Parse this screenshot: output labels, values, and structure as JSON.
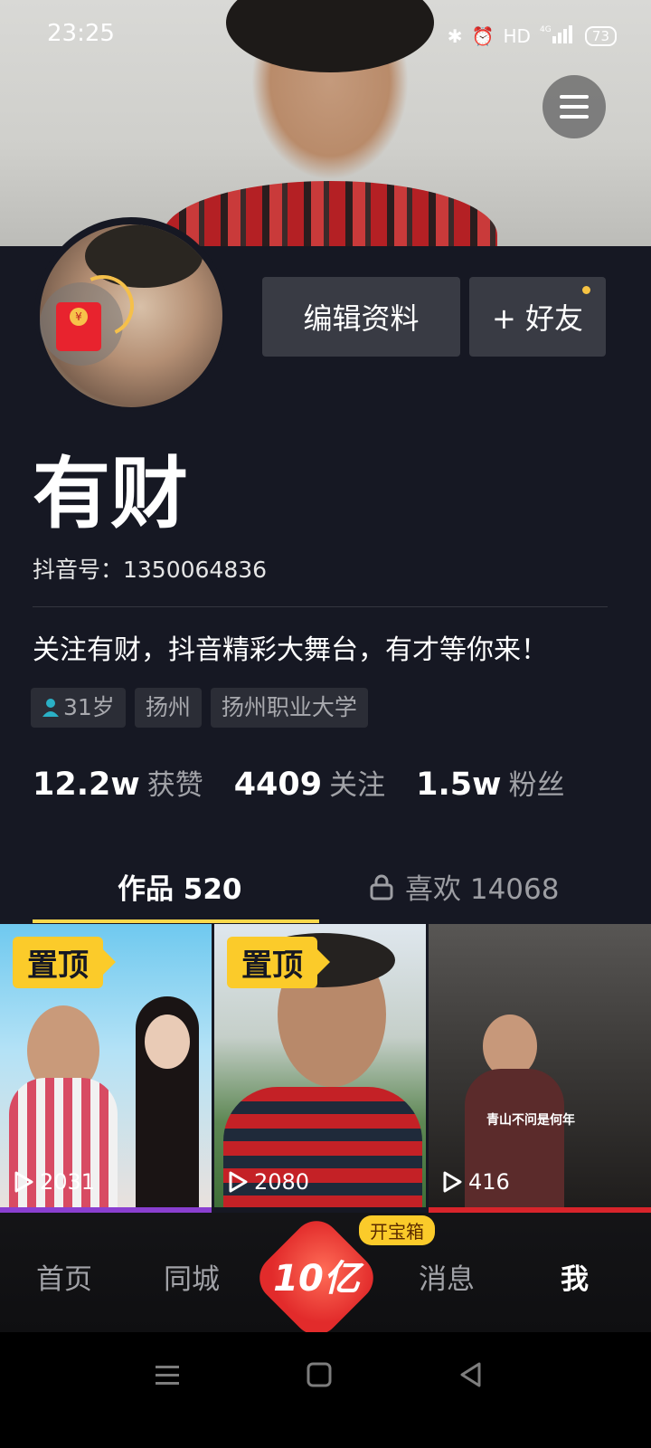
{
  "status_bar": {
    "time": "23:25",
    "network": "HD",
    "signal": "4G",
    "battery": "73"
  },
  "profile": {
    "name": "有财",
    "douyin_id": "抖音号：1350064836",
    "bio": "关注有财，抖音精彩大舞台，有才等你来！",
    "tags": [
      "31岁",
      "扬州",
      "扬州职业大学"
    ],
    "edit_label": "编辑资料",
    "friend_label": "+ 好友"
  },
  "stats": [
    {
      "value": "12.2w",
      "label": "获赞"
    },
    {
      "value": "4409",
      "label": "关注"
    },
    {
      "value": "1.5w",
      "label": "粉丝"
    }
  ],
  "tabs": {
    "works": "作品 520",
    "likes": "喜欢 14068"
  },
  "videos": [
    {
      "pinned": "置顶",
      "plays": "2031"
    },
    {
      "pinned": "置顶",
      "plays": "2080"
    },
    {
      "pinned": "",
      "plays": "416",
      "caption": "青山不问是何年"
    }
  ],
  "treasure": {
    "label": "开宝箱",
    "amount": "10亿"
  },
  "nav": {
    "home": "首页",
    "city": "同城",
    "messages": "消息",
    "me": "我"
  },
  "colors": {
    "background": "#161823",
    "accent": "#fbcb2a",
    "tab_underline": "#fbd94b",
    "button": "#393b44"
  }
}
